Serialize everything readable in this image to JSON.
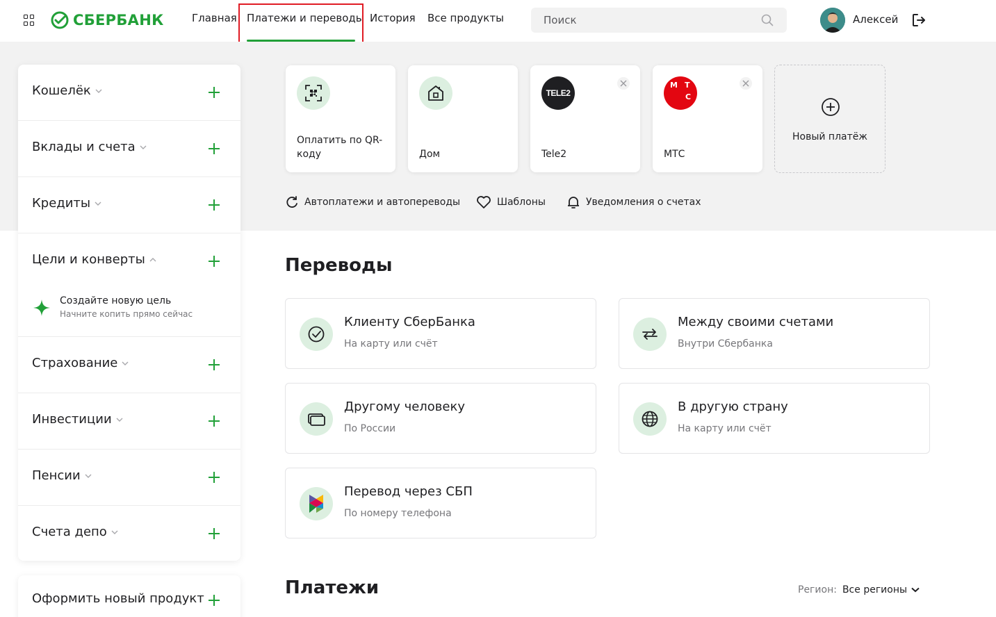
{
  "header": {
    "brand": "СБЕРБАНК",
    "nav": [
      "Главная",
      "Платежи и переводы",
      "История",
      "Все продукты"
    ],
    "search_placeholder": "Поиск",
    "user_name": "Алексей"
  },
  "sidebar": {
    "items": [
      {
        "label": "Кошелёк",
        "expanded": false
      },
      {
        "label": "Вклады и счета",
        "expanded": false
      },
      {
        "label": "Кредиты",
        "expanded": false
      },
      {
        "label": "Цели и конверты",
        "expanded": true
      },
      {
        "label": "Страхование",
        "expanded": false
      },
      {
        "label": "Инвестиции",
        "expanded": false
      },
      {
        "label": "Пенсии",
        "expanded": false
      },
      {
        "label": "Счета депо",
        "expanded": false
      }
    ],
    "goal": {
      "title": "Создайте новую цель",
      "description": "Начните копить прямо сейчас"
    },
    "new_product": "Оформить новый продукт"
  },
  "quick_payments": {
    "tiles": [
      {
        "label": "Оплатить по QR-коду",
        "icon": "qr-code-icon"
      },
      {
        "label": "Дом",
        "icon": "home-icon"
      },
      {
        "label": "Tele2",
        "icon": "tele2-logo"
      },
      {
        "label": "МТС",
        "icon": "mts-logo"
      }
    ],
    "tele2_logo_text": "TELE2",
    "mts_logo_letters": [
      "М",
      "Т",
      "С"
    ],
    "new_payment": "Новый платёж",
    "links": [
      "Автоплатежи и автопереводы",
      "Шаблоны",
      "Уведомления о счетах"
    ]
  },
  "transfers": {
    "title": "Переводы",
    "cards": [
      {
        "title": "Клиенту СберБанка",
        "subtitle": "На карту или счёт",
        "icon": "sber-check-icon"
      },
      {
        "title": "Между своими счетами",
        "subtitle": "Внутри Сбербанка",
        "icon": "swap-arrows-icon"
      },
      {
        "title": "Другому человеку",
        "subtitle": "По России",
        "icon": "cards-icon"
      },
      {
        "title": "В другую страну",
        "subtitle": "На карту или счёт",
        "icon": "globe-icon"
      },
      {
        "title": "Перевод через СБП",
        "subtitle": "По номеру телефона",
        "icon": "sbp-icon"
      }
    ]
  },
  "payments": {
    "title": "Платежи",
    "region_label": "Регион:",
    "region_value": "Все регионы"
  },
  "colors": {
    "brand_green": "#21a038",
    "highlight_red": "#e01b24",
    "icon_bg": "#dcefe0",
    "band_gray": "#f2f2f2"
  }
}
